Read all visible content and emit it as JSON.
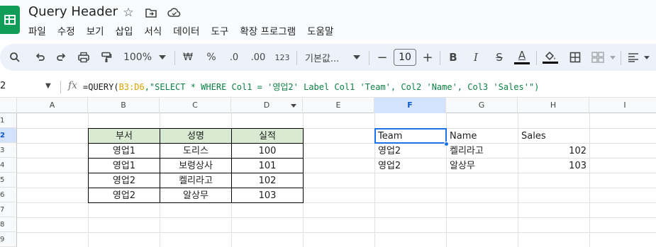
{
  "app": {
    "doc_title": "Query Header",
    "menu": [
      "파일",
      "수정",
      "보기",
      "삽입",
      "서식",
      "데이터",
      "도구",
      "확장 프로그램",
      "도움말"
    ]
  },
  "toolbar": {
    "zoom": "100%",
    "currency_symbol": "₩",
    "percent_symbol": "%",
    "decrease_decimal": ".0",
    "increase_decimal": ".00",
    "number_format": "123",
    "font_name": "기본값...",
    "font_size": "10",
    "minus": "−",
    "plus": "+",
    "bold": "B",
    "italic": "I",
    "strike": "S",
    "text_color": "A",
    "text_color_value": "#000000",
    "fill_color_value": "#000000"
  },
  "formula_bar": {
    "name_box": "2",
    "fx": "fx",
    "formula_prefix": "=QUERY(",
    "formula_range": "B3:D6",
    "formula_string": ",\"SELECT * WHERE Col1 = '영업2' Label Col1 'Team', Col2 'Name', Col3 'Sales'\")"
  },
  "grid": {
    "columns": [
      "A",
      "B",
      "C",
      "D",
      "E",
      "F",
      "G",
      "H",
      "I"
    ],
    "rows": [
      "1",
      "2",
      "3",
      "4",
      "5",
      "6",
      "7",
      "8",
      "9"
    ],
    "selected_column": "F",
    "selected_row": "2",
    "source_table": {
      "headers": [
        "부서",
        "성명",
        "실적"
      ],
      "rows": [
        [
          "영업1",
          "도리스",
          "100"
        ],
        [
          "영업1",
          "보령상사",
          "101"
        ],
        [
          "영업2",
          "켈리라고",
          "102"
        ],
        [
          "영업2",
          "알상무",
          "103"
        ]
      ],
      "header_fill": "#d9ead3"
    },
    "query_result": {
      "headers": [
        "Team",
        "Name",
        "Sales"
      ],
      "rows": [
        [
          "영업2",
          "켈리라고",
          "102"
        ],
        [
          "영업2",
          "알상무",
          "103"
        ]
      ]
    }
  },
  "colors": {
    "selection": "#1a73e8",
    "toolbar_bg": "#edf2fa",
    "logo": "#0f9d58"
  }
}
